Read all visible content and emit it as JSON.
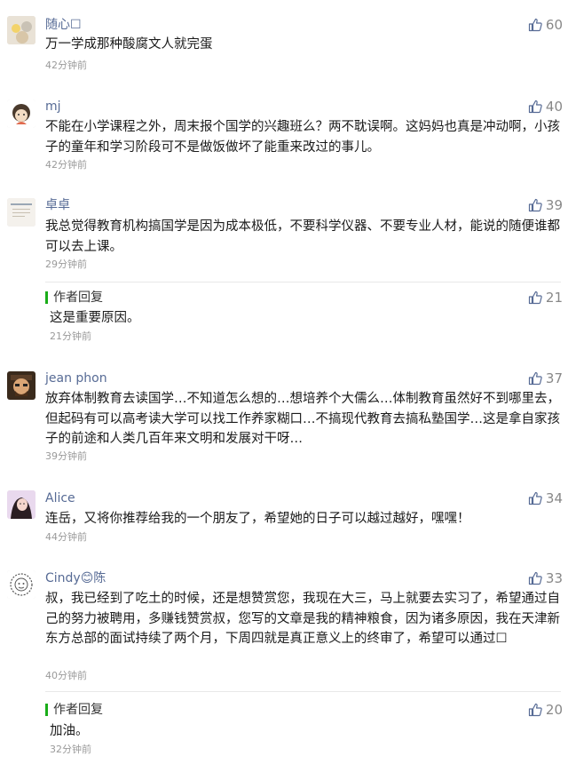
{
  "comments": [
    {
      "nickname": "随心☐",
      "likes": "60",
      "text": "万一学成那种酸腐文人就完蛋",
      "time": "42分钟前"
    },
    {
      "nickname": "mj",
      "likes": "40",
      "text": "不能在小学课程之外，周末报个国学的兴趣班么？两不耽误啊。这妈妈也真是冲动啊，小孩子的童年和学习阶段可不是做饭做坏了能重来改过的事儿。",
      "time": "42分钟前"
    },
    {
      "nickname": "卓卓",
      "likes": "39",
      "text": "我总觉得教育机构搞国学是因为成本极低，不要科学仪器、不要专业人材，能说的随便谁都可以去上课。",
      "time": "29分钟前",
      "reply": {
        "label": "作者回复",
        "likes": "21",
        "text": "这是重要原因。",
        "time": "21分钟前"
      }
    },
    {
      "nickname": "jean phon",
      "likes": "37",
      "text": "放弃体制教育去读国学…不知道怎么想的…想培养个大儒么…体制教育虽然好不到哪里去，但起码有可以高考读大学可以找工作养家糊口…不搞现代教育去搞私塾国学…这是拿自家孩子的前途和人类几百年来文明和发展对干呀…",
      "time": "39分钟前"
    },
    {
      "nickname": "Alice",
      "likes": "34",
      "text": "连岳，又将你推荐给我的一个朋友了，希望她的日子可以越过越好，嘿嘿！",
      "time": "44分钟前"
    },
    {
      "nickname": "Cindy😊陈",
      "likes": "33",
      "text": "叔，我已经到了吃土的时候，还是想赞赏您，我现在大三，马上就要去实习了，希望通过自己的努力被聘用，多赚钱赞赏叔，您写的文章是我的精神粮食，因为诸多原因，我在天津新东方总部的面试持续了两个月，下周四就是真正意义上的终审了，希望可以通过☐",
      "time": "40分钟前",
      "reply": {
        "label": "作者回复",
        "likes": "20",
        "text": "加油。",
        "time": "32分钟前"
      }
    }
  ],
  "avatars": [
    "flower-child-photo",
    "cartoon-girl-avatar",
    "book-cover-avatar",
    "bearded-man-avatar",
    "girl-photo-avatar",
    "lion-sketch-avatar"
  ],
  "colors": {
    "nickname": "#576b95",
    "reply_bar": "#1aad19",
    "muted": "#9a9a9a"
  }
}
